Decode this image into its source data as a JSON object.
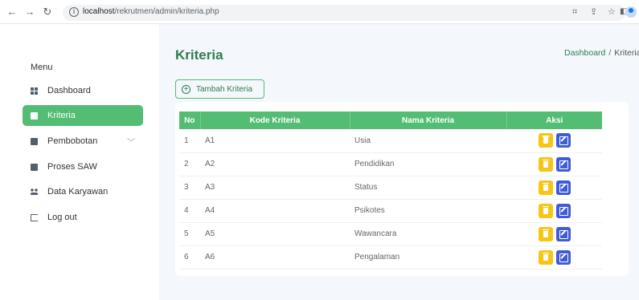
{
  "browser": {
    "url_host": "localhost",
    "url_path": "/rekrutmen/admin/kriteria.php"
  },
  "sidebar": {
    "title": "Menu",
    "items": [
      {
        "label": "Dashboard",
        "icon": "dashboard-grid-icon"
      },
      {
        "label": "Kriteria",
        "icon": "document-icon",
        "active": true
      },
      {
        "label": "Pembobotan",
        "icon": "document-icon",
        "expandable": true
      },
      {
        "label": "Proses SAW",
        "icon": "document-icon"
      },
      {
        "label": "Data Karyawan",
        "icon": "people-icon"
      },
      {
        "label": "Log out",
        "icon": "logout-icon"
      }
    ]
  },
  "main": {
    "title": "Kriteria",
    "breadcrumb": {
      "link": "Dashboard",
      "separator": "/",
      "current": "Kriteria"
    },
    "add_button": "Tambah Kriteria",
    "table": {
      "headers": [
        "No",
        "Kode Kriteria",
        "Nama Kriteria",
        "Aksi"
      ],
      "rows": [
        {
          "no": "1",
          "kode": "A1",
          "nama": "Usia"
        },
        {
          "no": "2",
          "kode": "A2",
          "nama": "Pendidikan"
        },
        {
          "no": "3",
          "kode": "A3",
          "nama": "Status"
        },
        {
          "no": "4",
          "kode": "A4",
          "nama": "Psikotes"
        },
        {
          "no": "5",
          "kode": "A5",
          "nama": "Wawancara"
        },
        {
          "no": "6",
          "kode": "A6",
          "nama": "Pengalaman"
        }
      ]
    }
  },
  "colors": {
    "accent": "#52bd73",
    "title": "#2e7d4f",
    "delete": "#f7c615",
    "edit": "#3f5bd6"
  }
}
